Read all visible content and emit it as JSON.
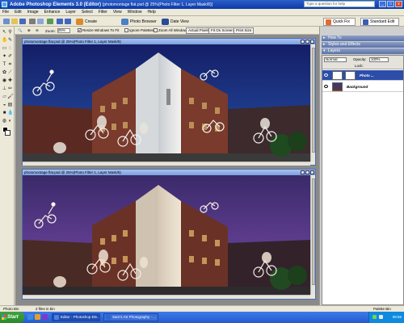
{
  "window": {
    "title_bold": "Adobe Photoshop Elements 3.0 (Editor)",
    "title_doc": "[photomontage flat.psd @ 25%(Photo Filter 1, Layer Mask/8)]",
    "help_placeholder": "Type a question for help",
    "min": "_",
    "max": "□",
    "close": "x"
  },
  "menu": [
    "File",
    "Edit",
    "Image",
    "Enhance",
    "Layer",
    "Select",
    "Filter",
    "View",
    "Window",
    "Help"
  ],
  "shortcuts": {
    "create": "Create",
    "photo_browser": "Photo Browser",
    "date_view": "Date View",
    "quick_fix": "Quick Fix",
    "standard_edit": "Standard Edit"
  },
  "options": {
    "zoom_label": "Zoom:",
    "zoom_value": "25%",
    "resize_windows": "Resize Windows To Fit",
    "ignore_palettes": "Ignore Palettes",
    "zoom_all": "Zoom All Windows",
    "actual_pixels": "Actual Pixels",
    "fit_on_screen": "Fit On Screen",
    "print_size": "Print Size",
    "resize_checked": "✔"
  },
  "docs": [
    {
      "title": "photomontage flat.psd @ 25%(Photo Filter 1, Layer Mask/8)"
    },
    {
      "title": "photomontage flat.psd @ 25%(Photo Filter 1, Layer Mask/8)"
    }
  ],
  "status": {
    "photo_bin": "Photo Bin",
    "files_in_bin": "2 files in bin",
    "palette_bin": "Palette Bin"
  },
  "palettes": {
    "how_to": "How To",
    "styles_effects": "Styles and Effects",
    "layers": "Layers",
    "blend_mode": "Normal",
    "opacity_label": "Opacity:",
    "opacity_value": "100%",
    "lock_label": "Lock:",
    "layer_items": [
      {
        "name": "Photo ..."
      },
      {
        "name": "Background"
      }
    ]
  },
  "taskbar": {
    "start": "Start",
    "tasks": [
      "Editor - Photoshop Ele...",
      "Sam's AS Photography - ..."
    ],
    "clock": "09:56"
  },
  "colors": {
    "title_blue": "#0a3aa8",
    "layer_selected": "#2c4da8",
    "sky_top": "#141e66",
    "sky_purple": "#4a2a7a"
  }
}
